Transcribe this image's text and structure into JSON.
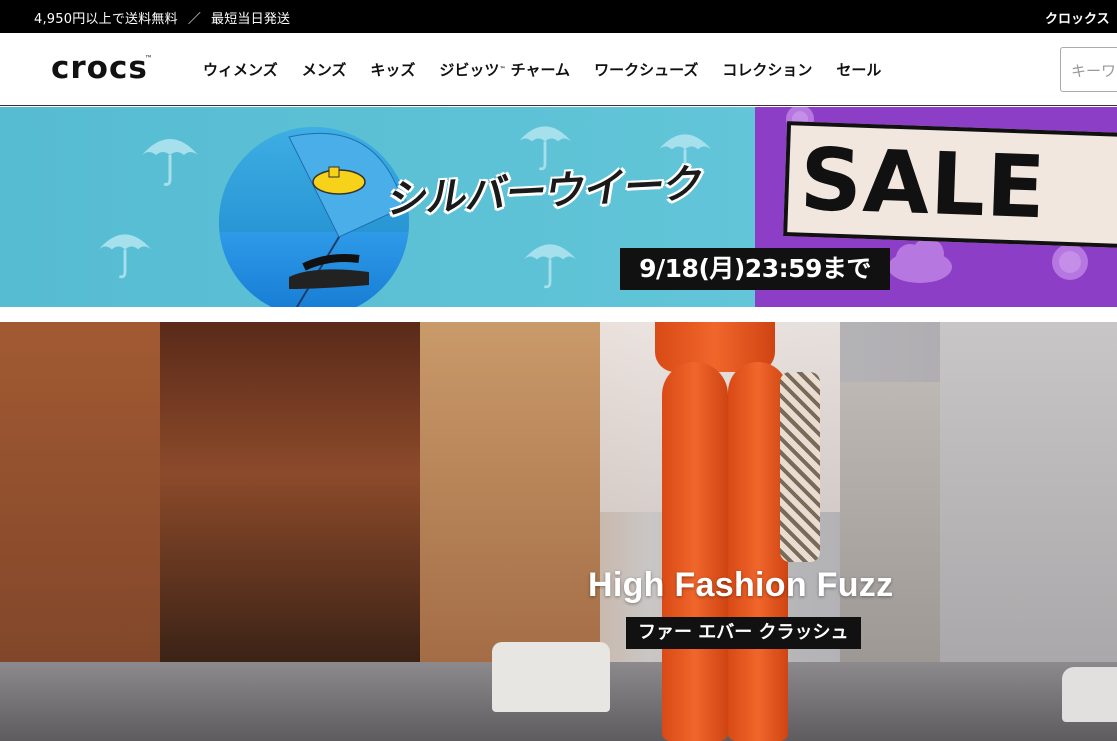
{
  "topbar": {
    "promo_shipping": "4,950円以上で送料無料",
    "separator": "／",
    "promo_dispatch": "最短当日発送",
    "right_link": "クロックス"
  },
  "header": {
    "logo": "crocs",
    "logo_tm": "™",
    "nav": [
      {
        "label": "ウィメンズ"
      },
      {
        "label": "メンズ"
      },
      {
        "label": "キッズ"
      },
      {
        "label": "ジビッツ",
        "sup": "™",
        "suffix": " チャーム"
      },
      {
        "label": "ワークシューズ"
      },
      {
        "label": "コレクション"
      },
      {
        "label": "セール"
      }
    ],
    "search_placeholder": "キーワ"
  },
  "sale_banner": {
    "title": "シルバーウイーク",
    "sale_word": "SALE",
    "date": "9/18(月)23:59まで",
    "colors": {
      "left_bg": "#5dc2d6",
      "right_bg": "#8c3fc6",
      "badge": "#111111"
    }
  },
  "hero": {
    "title": "High Fashion Fuzz",
    "subtitle": "ファー エバー クラッシュ",
    "colors": {
      "accent": "#e8581f"
    }
  }
}
